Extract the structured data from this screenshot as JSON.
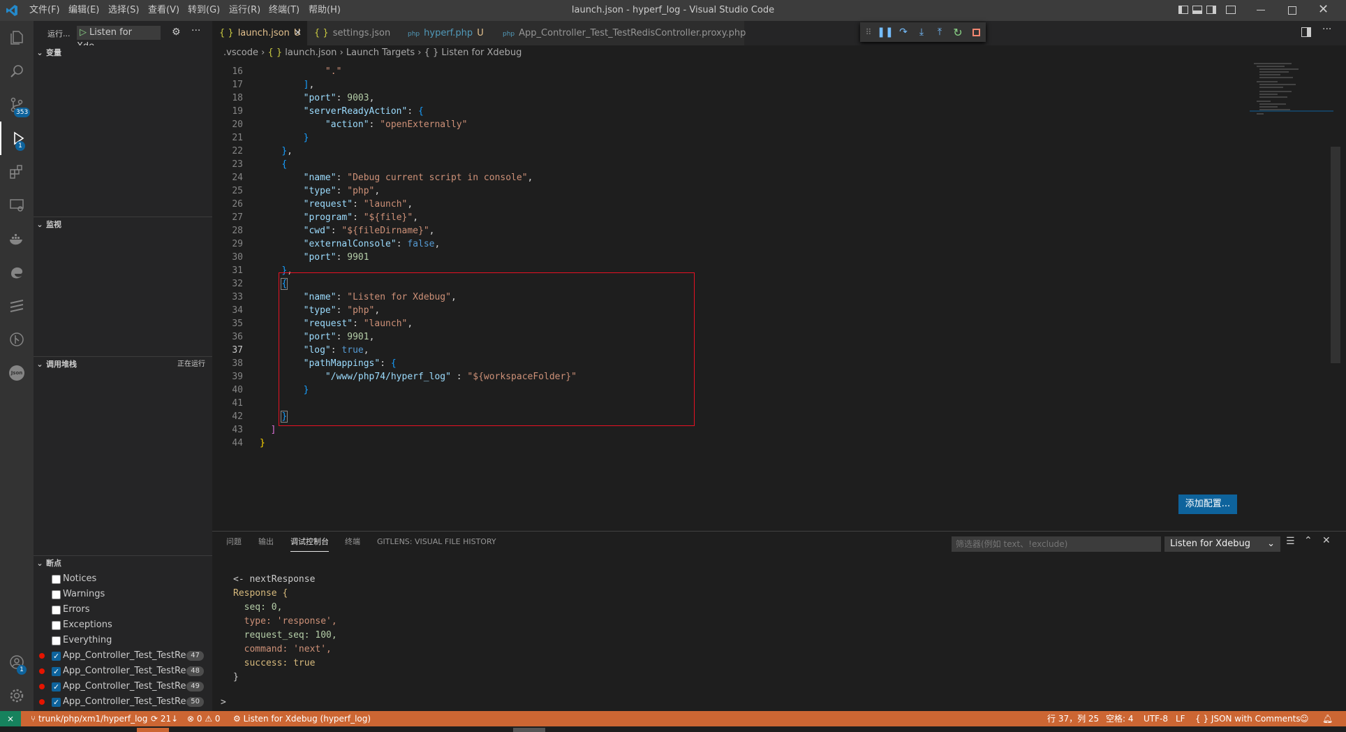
{
  "window": {
    "title": "launch.json - hyperf_log - Visual Studio Code"
  },
  "menu": [
    "文件(F)",
    "编辑(E)",
    "选择(S)",
    "查看(V)",
    "转到(G)",
    "运行(R)",
    "终端(T)",
    "帮助(H)"
  ],
  "activity": {
    "scm_badge": "353",
    "debug_badge": "1",
    "accounts_badge": "1"
  },
  "sidebar": {
    "run_label": "运行...",
    "config_name": "Listen for Xde",
    "variables_title": "变量",
    "watch_title": "监视",
    "callstack_title": "调用堆栈",
    "callstack_status": "正在运行",
    "breakpoints_title": "断点",
    "exceptions": [
      "Notices",
      "Warnings",
      "Errors",
      "Exceptions",
      "Everything"
    ],
    "breakpoints": [
      {
        "label": "App_Controller_Test_TestRed...",
        "line": "47"
      },
      {
        "label": "App_Controller_Test_TestRed...",
        "line": "48"
      },
      {
        "label": "App_Controller_Test_TestRed...",
        "line": "49"
      },
      {
        "label": "App_Controller_Test_TestRed...",
        "line": "50"
      }
    ]
  },
  "tabs": [
    {
      "icon": "{ }",
      "label": "launch.json",
      "status": "U"
    },
    {
      "icon": "{ }",
      "label": "settings.json",
      "status": ""
    },
    {
      "icon": "php",
      "label": "hyperf.php",
      "status": "U"
    },
    {
      "icon": "php",
      "label": "App_Controller_Test_TestRedisController.proxy.php",
      "status": ""
    }
  ],
  "breadcrumb": [
    ".vscode",
    "launch.json",
    "Launch Targets",
    "Listen for Xdebug"
  ],
  "editor": {
    "line_numbers": [
      "16",
      "17",
      "18",
      "19",
      "20",
      "21",
      "22",
      "23",
      "24",
      "25",
      "26",
      "27",
      "28",
      "29",
      "30",
      "31",
      "32",
      "33",
      "34",
      "35",
      "36",
      "37",
      "38",
      "39",
      "40",
      "41",
      "42",
      "43",
      "44"
    ],
    "current_line": "37"
  },
  "add_config_button": "添加配置...",
  "panel": {
    "tabs": [
      "问题",
      "输出",
      "调试控制台",
      "终端",
      "GITLENS: VISUAL FILE HISTORY"
    ],
    "filter_placeholder": "筛选器(例如 text、!exclude)",
    "config_select": "Listen for Xdebug",
    "console_lines": [
      "<- nextResponse",
      "Response {",
      "  seq: 0,",
      "  type: 'response',",
      "  request_seq: 100,",
      "  command: 'next',",
      "  success: true",
      "}"
    ],
    "prompt": ">"
  },
  "statusbar": {
    "branch": "trunk/php/xm1/hyperf_log",
    "sync": "21↓",
    "errors": "0",
    "warnings": "0",
    "debug_session": "Listen for Xdebug (hyperf_log)",
    "position": "行 37，列 25",
    "spaces": "空格: 4",
    "encoding": "UTF-8",
    "eol": "LF",
    "language": "JSON with Comments"
  },
  "colors": {
    "statusbar": "#cc6633",
    "accent": "#0e639c",
    "highlight_box": "#e81123"
  }
}
